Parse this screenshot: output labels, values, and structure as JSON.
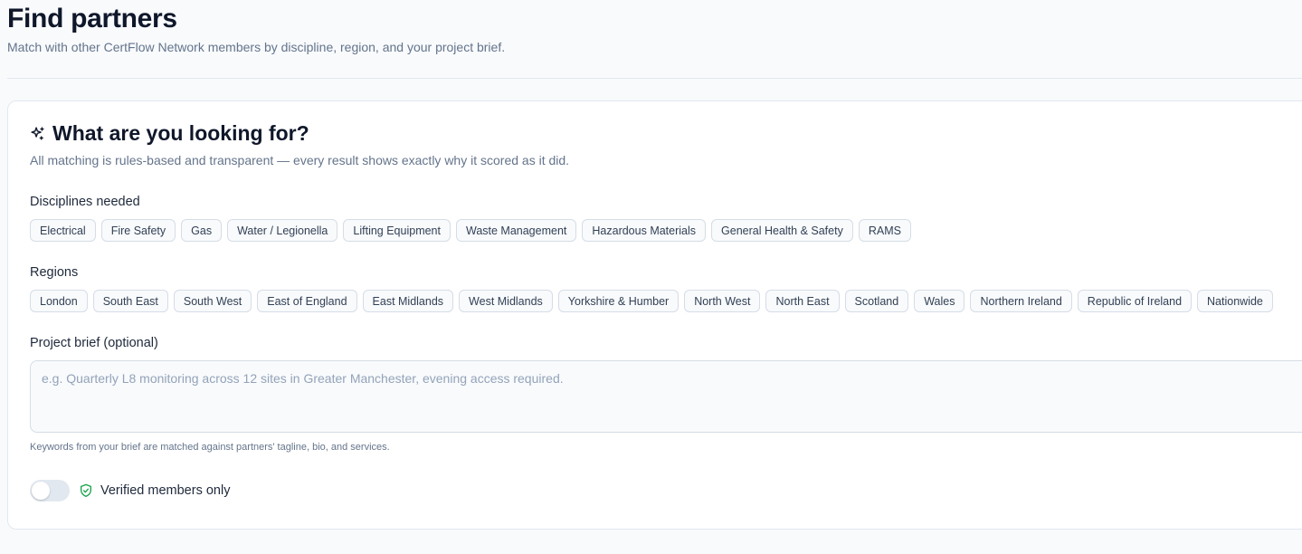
{
  "header": {
    "title": "Find partners",
    "subtitle": "Match with other CertFlow Network members by discipline, region, and your project brief."
  },
  "search_card": {
    "icon": "sparkle-icon",
    "title": "What are you looking for?",
    "subtitle": "All matching is rules-based and transparent — every result shows exactly why it scored as it did.",
    "disciplines": {
      "label": "Disciplines needed",
      "options": [
        "Electrical",
        "Fire Safety",
        "Gas",
        "Water / Legionella",
        "Lifting Equipment",
        "Waste Management",
        "Hazardous Materials",
        "General Health & Safety",
        "RAMS"
      ]
    },
    "regions": {
      "label": "Regions",
      "options": [
        "London",
        "South East",
        "South West",
        "East of England",
        "East Midlands",
        "West Midlands",
        "Yorkshire & Humber",
        "North West",
        "North East",
        "Scotland",
        "Wales",
        "Northern Ireland",
        "Republic of Ireland",
        "Nationwide"
      ]
    },
    "brief": {
      "label": "Project brief (optional)",
      "value": "",
      "placeholder": "e.g. Quarterly L8 monitoring across 12 sites in Greater Manchester, evening access required.",
      "hint": "Keywords from your brief are matched against partners' tagline, bio, and services."
    },
    "verified_toggle": {
      "label": "Verified members only",
      "checked": false,
      "icon": "shield-check-icon",
      "icon_color": "#16a34a"
    }
  },
  "colors": {
    "text": "#0f172a",
    "muted": "#64748b",
    "chip_border": "#d6dde6",
    "background": "#f8fafc"
  }
}
